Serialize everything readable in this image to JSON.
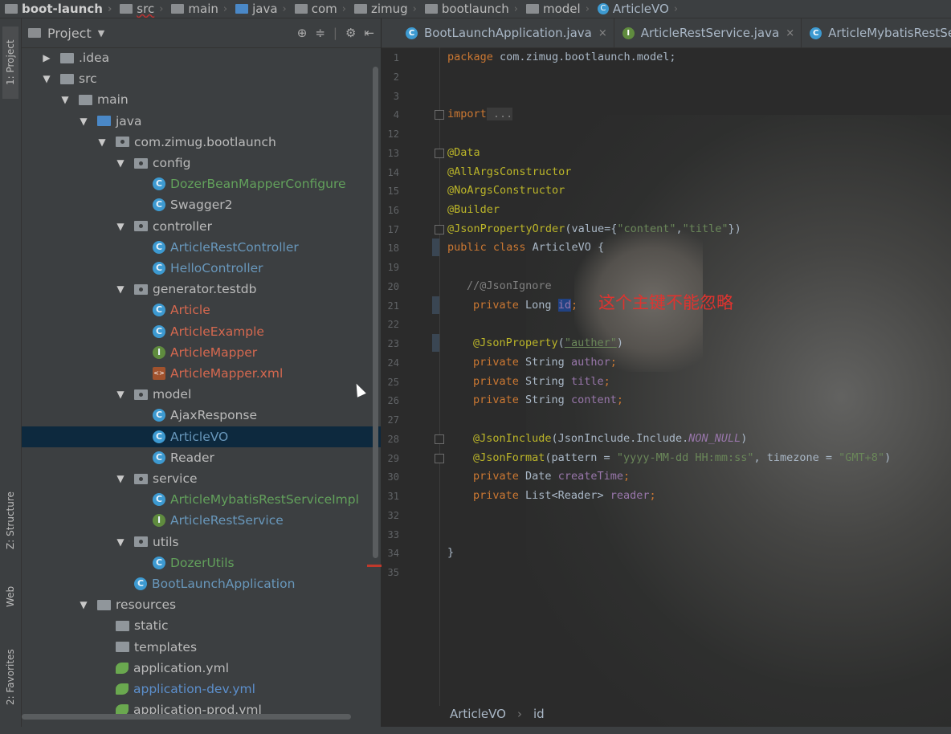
{
  "breadcrumb": {
    "items": [
      "boot-launch",
      "src",
      "main",
      "java",
      "com",
      "zimug",
      "bootlaunch",
      "model",
      "ArticleVO"
    ]
  },
  "toolstrip": {
    "project": "1: Project",
    "structure": "Z: Structure",
    "web": "Web",
    "favorites": "2: Favorites"
  },
  "project_panel": {
    "title": "Project",
    "tree": [
      {
        "label": ".idea",
        "icon": "folder-icon",
        "color": "#bbbbbb"
      },
      {
        "label": "src",
        "icon": "folder-icon",
        "color": "#bbbbbb"
      },
      {
        "label": "main",
        "icon": "folder-icon",
        "color": "#bbbbbb"
      },
      {
        "label": "java",
        "icon": "source-folder-icon",
        "color": "#bbbbbb"
      },
      {
        "label": "com.zimug.bootlaunch",
        "icon": "package-icon",
        "color": "#bbbbbb"
      },
      {
        "label": "config",
        "icon": "package-icon",
        "color": "#bbbbbb"
      },
      {
        "label": "DozerBeanMapperConfigure",
        "icon": "class-icon",
        "color": "#62a05b"
      },
      {
        "label": "Swagger2",
        "icon": "class-icon",
        "color": "#bbbbbb"
      },
      {
        "label": "controller",
        "icon": "package-icon",
        "color": "#bbbbbb"
      },
      {
        "label": "ArticleRestController",
        "icon": "class-icon",
        "color": "#6897bb"
      },
      {
        "label": "HelloController",
        "icon": "class-icon",
        "color": "#6897bb"
      },
      {
        "label": "generator.testdb",
        "icon": "package-icon",
        "color": "#bbbbbb"
      },
      {
        "label": "Article",
        "icon": "class-icon",
        "color": "#d5684f"
      },
      {
        "label": "ArticleExample",
        "icon": "class-icon",
        "color": "#d5684f"
      },
      {
        "label": "ArticleMapper",
        "icon": "interface-icon",
        "color": "#d5684f"
      },
      {
        "label": "ArticleMapper.xml",
        "icon": "xml-icon",
        "color": "#d5684f"
      },
      {
        "label": "model",
        "icon": "package-icon",
        "color": "#bbbbbb"
      },
      {
        "label": "AjaxResponse",
        "icon": "class-icon",
        "color": "#bbbbbb"
      },
      {
        "label": "ArticleVO",
        "icon": "class-icon",
        "color": "#6897bb"
      },
      {
        "label": "Reader",
        "icon": "class-icon",
        "color": "#bbbbbb"
      },
      {
        "label": "service",
        "icon": "package-icon",
        "color": "#bbbbbb"
      },
      {
        "label": "ArticleMybatisRestServiceImpl",
        "icon": "class-icon",
        "color": "#62a05b"
      },
      {
        "label": "ArticleRestService",
        "icon": "interface-icon",
        "color": "#6897bb"
      },
      {
        "label": "utils",
        "icon": "package-icon",
        "color": "#bbbbbb"
      },
      {
        "label": "DozerUtils",
        "icon": "class-icon",
        "color": "#62a05b"
      },
      {
        "label": "BootLaunchApplication",
        "icon": "spring-class-icon",
        "color": "#6897bb"
      },
      {
        "label": "resources",
        "icon": "resources-folder-icon",
        "color": "#bbbbbb"
      },
      {
        "label": "static",
        "icon": "folder-icon",
        "color": "#bbbbbb"
      },
      {
        "label": "templates",
        "icon": "folder-icon",
        "color": "#bbbbbb"
      },
      {
        "label": "application.yml",
        "icon": "yml-icon",
        "color": "#bbbbbb"
      },
      {
        "label": "application-dev.yml",
        "icon": "yml-icon",
        "color": "#5c8fcc"
      },
      {
        "label": "application-prod.yml",
        "icon": "yml-icon",
        "color": "#bbbbbb"
      }
    ],
    "selected": "ArticleVO"
  },
  "editor": {
    "tabs": [
      {
        "label": "BootLaunchApplication.java",
        "icon": "class-icon"
      },
      {
        "label": "ArticleRestService.java",
        "icon": "interface-icon"
      },
      {
        "label": "ArticleMybatisRestServ",
        "icon": "class-icon"
      }
    ],
    "line_numbers": [
      "1",
      "2",
      "3",
      "4",
      "12",
      "13",
      "14",
      "15",
      "16",
      "17",
      "18",
      "19",
      "20",
      "21",
      "22",
      "23",
      "24",
      "25",
      "26",
      "27",
      "28",
      "29",
      "30",
      "31",
      "32",
      "33",
      "34",
      "35"
    ],
    "code": {
      "l1_kw": "package",
      "l1_rest": " com.zimug.bootlaunch.model;",
      "l4_kw": "import",
      "l4_rest": " ...",
      "l13": "@Data",
      "l14": "@AllArgsConstructor",
      "l15": "@NoArgsConstructor",
      "l16": "@Builder",
      "l17_ann": "@JsonPropertyOrder",
      "l17_a": "(value={",
      "l17_s1": "\"content\"",
      "l17_c": ",",
      "l17_s2": "\"title\"",
      "l17_e": "})",
      "l18_kw": "public class",
      "l18_rest": " ArticleVO {",
      "l20": "//@JsonIgnore",
      "l21_kw": "private",
      "l21_type": " Long ",
      "l21_id": "id",
      "l21_end": ";",
      "l23_ann": "@JsonProperty",
      "l23_a": "(",
      "l23_s": "\"auther\"",
      "l23_e": ")",
      "l24_kw": "private",
      "l24_type": " String ",
      "l24_f": "author",
      "l25_kw": "private",
      "l25_type": " String ",
      "l25_f": "title",
      "l26_kw": "private",
      "l26_type": " String ",
      "l26_f": "content",
      "l28_ann": "@JsonInclude",
      "l28_a": "(JsonInclude.Include.",
      "l28_c": "NON_NULL",
      "l28_e": ")",
      "l29_ann": "@JsonFormat",
      "l29_a": "(pattern = ",
      "l29_s1": "\"yyyy-MM-dd HH:mm:ss\"",
      "l29_b": ", timezone = ",
      "l29_s2": "\"GMT+8\"",
      "l29_e": ")",
      "l30_kw": "private",
      "l30_type": " Date ",
      "l30_f": "createTime",
      "l31_kw": "private",
      "l31_type": " List<Reader> ",
      "l31_f": "reader",
      "semi": ";",
      "l34": "}"
    },
    "note": "这个主键不能忽略",
    "status_crumbs": [
      "ArticleVO",
      "id"
    ]
  }
}
